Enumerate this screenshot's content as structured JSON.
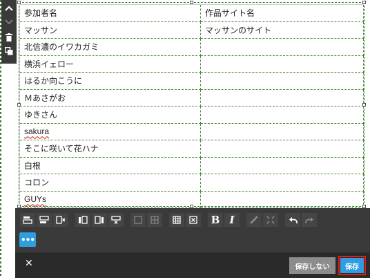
{
  "table": {
    "headers": [
      "参加者名",
      "作品サイト名"
    ],
    "rows": [
      [
        "マッサン",
        "マッサンのサイト"
      ],
      [
        "北信濃のイワカガミ",
        ""
      ],
      [
        "横浜イェロー",
        ""
      ],
      [
        "はるか向こうに",
        ""
      ],
      [
        "Ｍあさがお",
        ""
      ],
      [
        "ゆきさん",
        ""
      ],
      [
        "sakura",
        ""
      ],
      [
        "そこに咲いて花ハナ",
        ""
      ],
      [
        "白根",
        ""
      ],
      [
        "コロン",
        ""
      ],
      [
        "GUYs",
        ""
      ]
    ]
  },
  "toolbar": {
    "more_label": "•••"
  },
  "footer": {
    "close_label": "✕",
    "no_save_label": "保存しない",
    "save_label": "保存"
  },
  "colors": {
    "toolbar_bg": "#3a3a3a",
    "footer_bg": "#2a2a2a",
    "accent": "#2e9ee0",
    "highlight": "#e21b1b",
    "guide": "#2f7a2f"
  }
}
